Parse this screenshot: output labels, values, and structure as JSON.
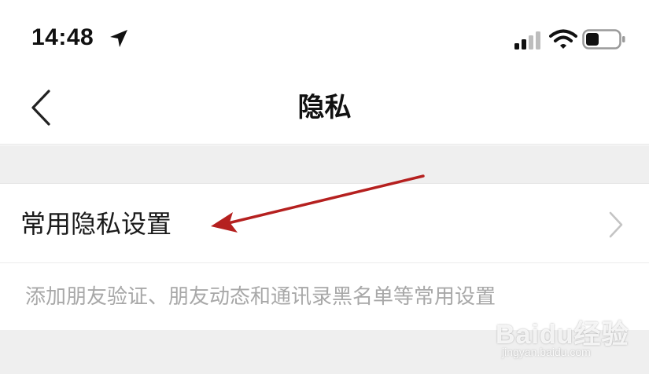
{
  "status_bar": {
    "time": "14:48",
    "icons": [
      "location-arrow-icon",
      "cellular-signal-icon",
      "wifi-icon",
      "battery-icon"
    ],
    "battery_level": 0.4
  },
  "nav": {
    "title": "隐私",
    "back_icon": "chevron-left-icon"
  },
  "settings": {
    "row_label": "常用隐私设置",
    "row_icon": "chevron-right-icon",
    "description": "添加朋友验证、朋友动态和通讯录黑名单等常用设置"
  },
  "annotation": {
    "type": "arrow",
    "color": "#b5201f"
  },
  "watermark": {
    "brand": "Baidu经验",
    "url": "jingyan.baidu.com"
  },
  "colors": {
    "background": "#ffffff",
    "section_gap": "#efefef",
    "description_text": "#a8a8a8",
    "divider": "#e6e6e6"
  }
}
